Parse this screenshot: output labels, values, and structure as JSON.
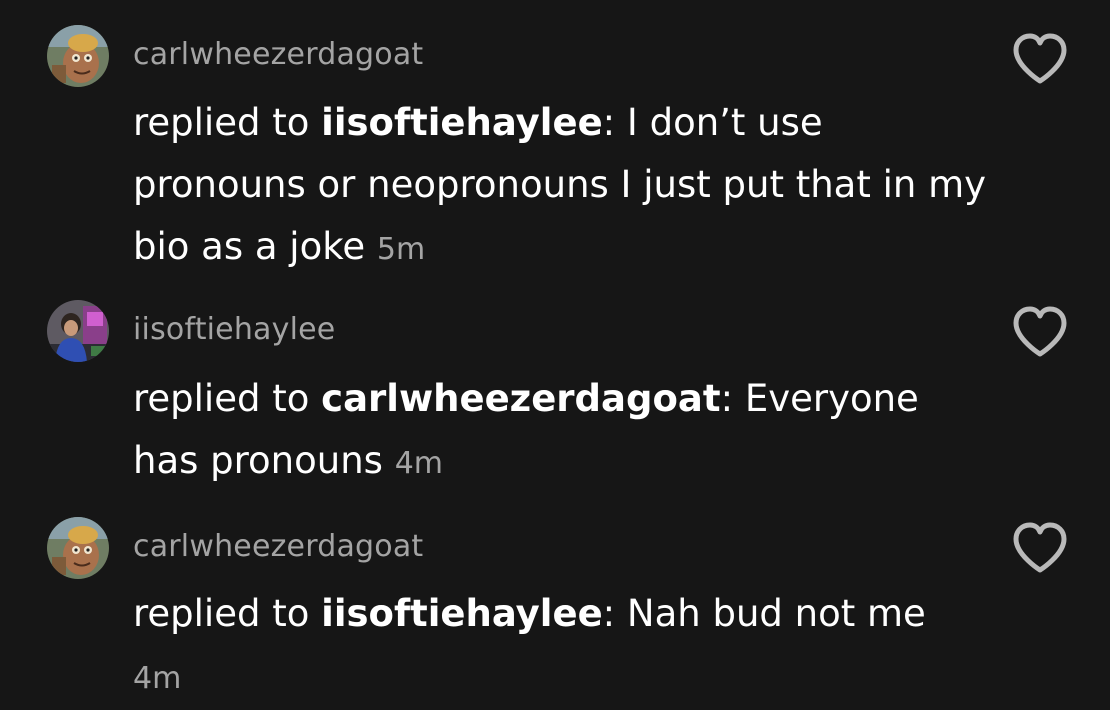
{
  "comments": [
    {
      "username": "carlwheezerdagoat",
      "reply_prefix": "replied to ",
      "reply_to": "iisoftiehaylee",
      "reply_suffix": ": ",
      "text": "I don’t use pronouns or neopronouns I just put that in my bio as a joke",
      "time": "5m",
      "avatar_icon": "cartoon-avatar",
      "like_icon": "heart-outline-icon"
    },
    {
      "username": "iisoftiehaylee",
      "reply_prefix": "replied to ",
      "reply_to": "carlwheezerdagoat",
      "reply_suffix": ": ",
      "text": "Everyone has pronouns",
      "time": "4m",
      "avatar_icon": "photo-avatar",
      "like_icon": "heart-outline-icon"
    },
    {
      "username": "carlwheezerdagoat",
      "reply_prefix": "replied to ",
      "reply_to": "iisoftiehaylee",
      "reply_suffix": ": ",
      "text": "Nah bud not me",
      "time": "4m",
      "avatar_icon": "cartoon-avatar",
      "like_icon": "heart-outline-icon"
    }
  ],
  "colors": {
    "background": "#161616",
    "text": "#ffffff",
    "muted": "#a4a4a4",
    "icon": "#b9b9b9"
  }
}
